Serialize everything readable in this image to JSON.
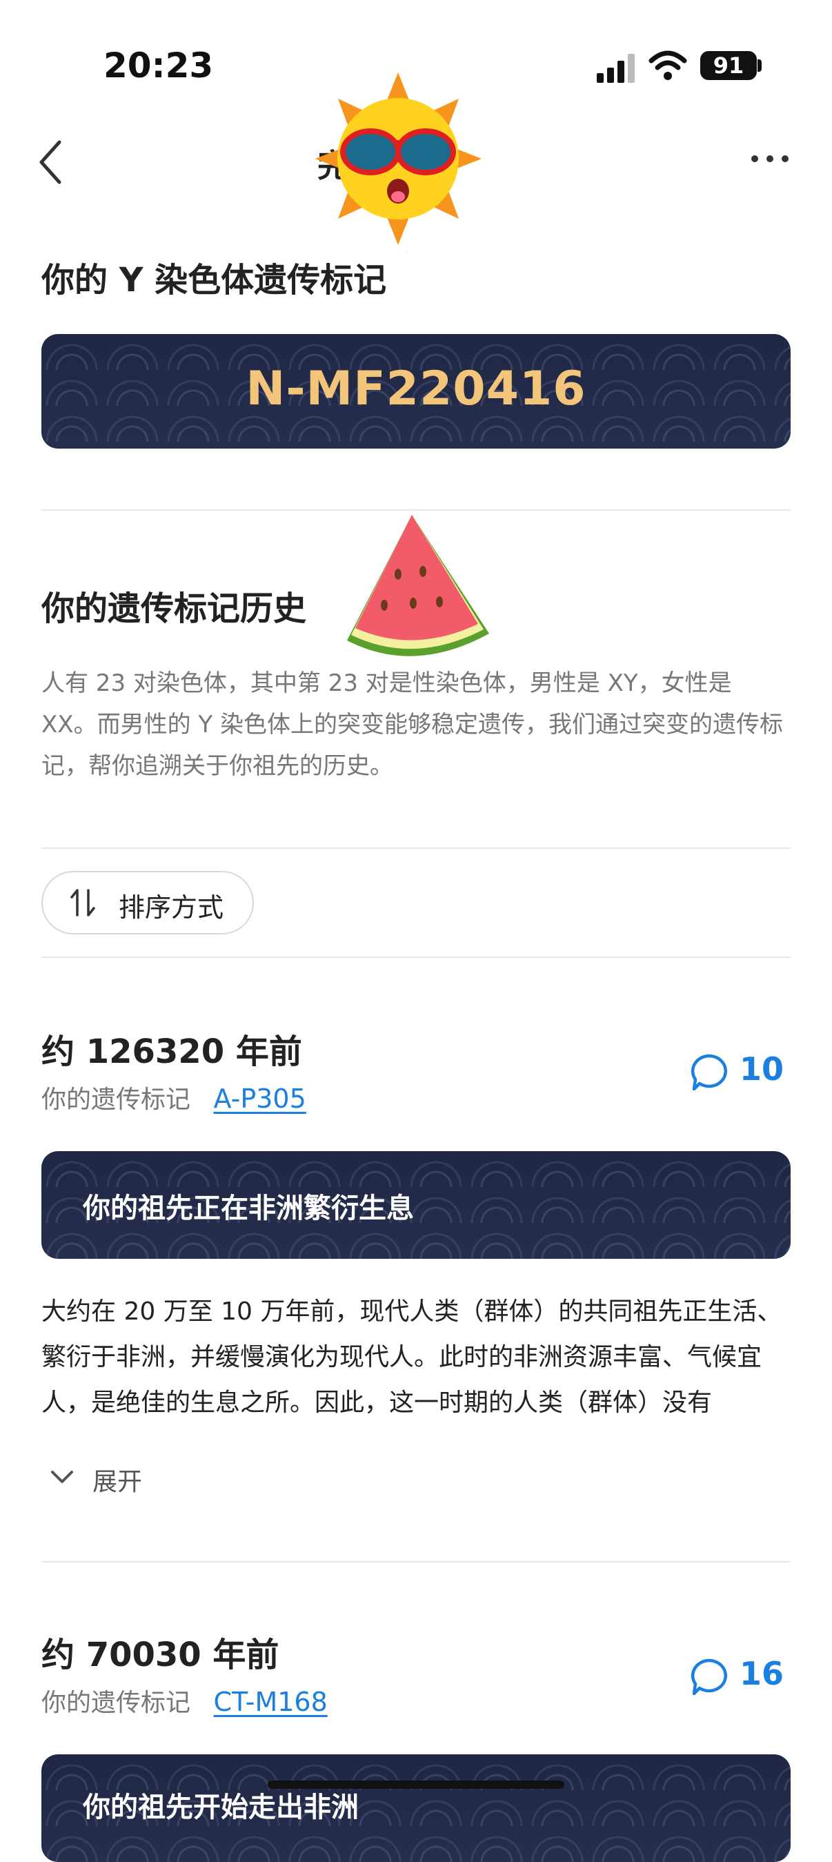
{
  "status_bar": {
    "time": "20:23",
    "battery": "91"
  },
  "nav": {
    "title": "完"
  },
  "y_marker": {
    "heading": "你的 Y 染色体遗传标记",
    "haplogroup": "N-MF220416"
  },
  "history": {
    "heading": "你的遗传标记历史",
    "intro": "人有 23 对染色体，其中第 23 对是性染色体，男性是 XY，女性是 XX。而男性的 Y 染色体上的突变能够稳定遗传，我们通过突变的遗传标记，帮你追溯关于你祖先的历史。"
  },
  "sort": {
    "label": "排序方式"
  },
  "eras": [
    {
      "title": "约 126320 年前",
      "marker_label": "你的遗传标记",
      "marker": "A-P305",
      "comments": "10",
      "banner": "你的祖先正在非洲繁衍生息",
      "desc": "大约在 20 万至 10 万年前，现代人类（群体）的共同祖先正生活、繁衍于非洲，并缓慢演化为现代人。此时的非洲资源丰富、气候宜人，是绝佳的生息之所。因此，这一时期的人类（群体）没有",
      "expand": "展开"
    },
    {
      "title": "约 70030 年前",
      "marker_label": "你的遗传标记",
      "marker": "CT-M168",
      "comments": "16",
      "banner": "你的祖先开始走出非洲"
    }
  ],
  "colors": {
    "accent": "#1a7fe0",
    "banner_bg": "#1f2744",
    "haplogroup_gold": "#f2c57a"
  }
}
